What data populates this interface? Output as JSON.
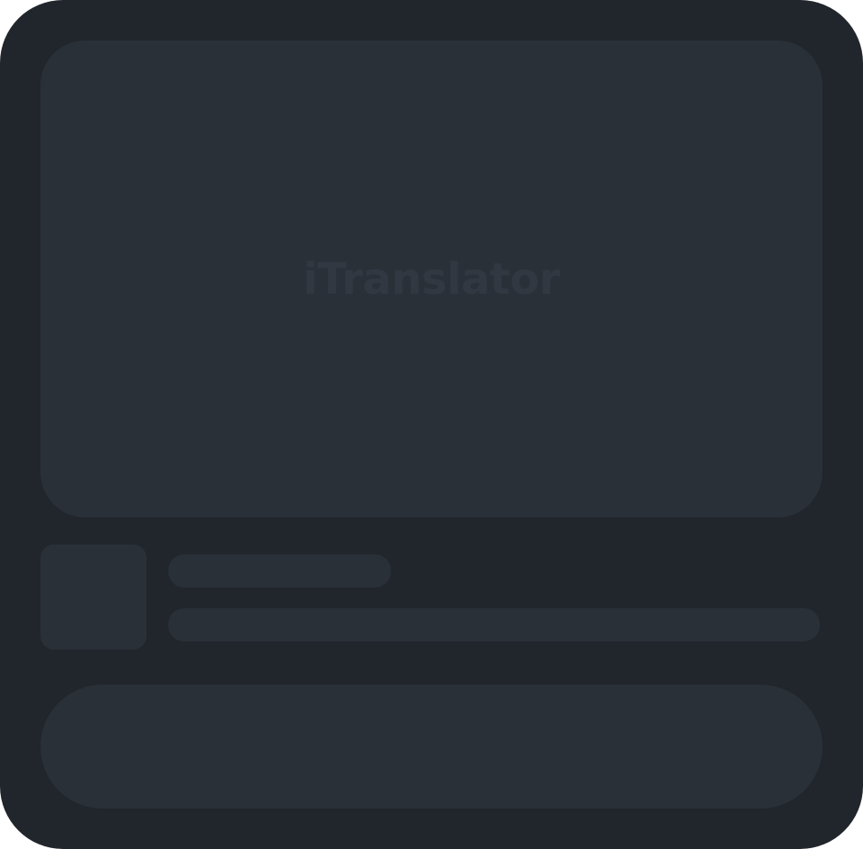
{
  "app": {
    "title": "iTranslator"
  },
  "colors": {
    "background": "#21252c",
    "placeholder": "#2a3038",
    "title_text": "#323841"
  }
}
